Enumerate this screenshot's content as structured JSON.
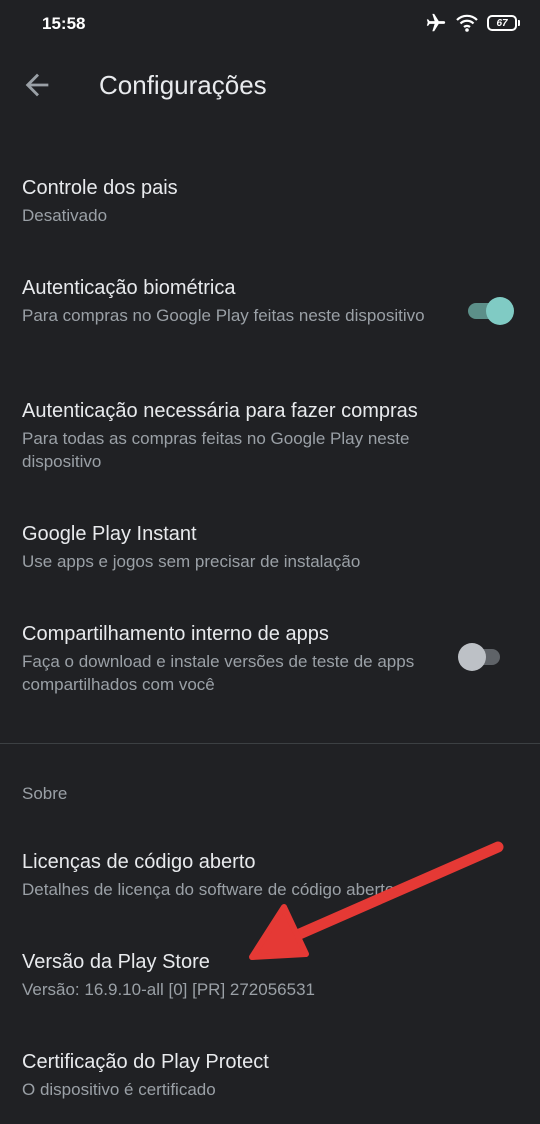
{
  "status_bar": {
    "time": "15:58",
    "battery": "67",
    "icons": [
      "airplane-icon",
      "wifi-icon",
      "battery-icon"
    ]
  },
  "header": {
    "title": "Configurações",
    "back_icon": "arrow-back-icon"
  },
  "settings": [
    {
      "title": "Controle dos pais",
      "subtitle": "Desativado"
    },
    {
      "title": "Autenticação biométrica",
      "subtitle": "Para compras no Google Play feitas neste dispositivo",
      "toggle": "on"
    },
    {
      "title": "Autenticação necessária para fazer compras",
      "subtitle": "Para todas as compras feitas no Google Play neste dispositivo"
    },
    {
      "title": "Google Play Instant",
      "subtitle": "Use apps e jogos sem precisar de instalação"
    },
    {
      "title": "Compartilhamento interno de apps",
      "subtitle": "Faça o download e instale versões de teste de apps compartilhados com você",
      "toggle": "off"
    }
  ],
  "about": {
    "header": "Sobre",
    "items": [
      {
        "title": "Licenças de código aberto",
        "subtitle": "Detalhes de licença do software de código aberto"
      },
      {
        "title": "Versão da Play Store",
        "subtitle": "Versão: 16.9.10-all [0] [PR] 272056531"
      },
      {
        "title": "Certificação do Play Protect",
        "subtitle": "O dispositivo é certificado"
      }
    ]
  },
  "colors": {
    "background": "#202124",
    "primary_text": "#e8eaed",
    "secondary_text": "#9aa0a6",
    "toggle_on": "#80cbc4",
    "annotation_arrow": "#e53935"
  },
  "annotation": {
    "type": "arrow",
    "icon": "red-arrow-icon"
  }
}
